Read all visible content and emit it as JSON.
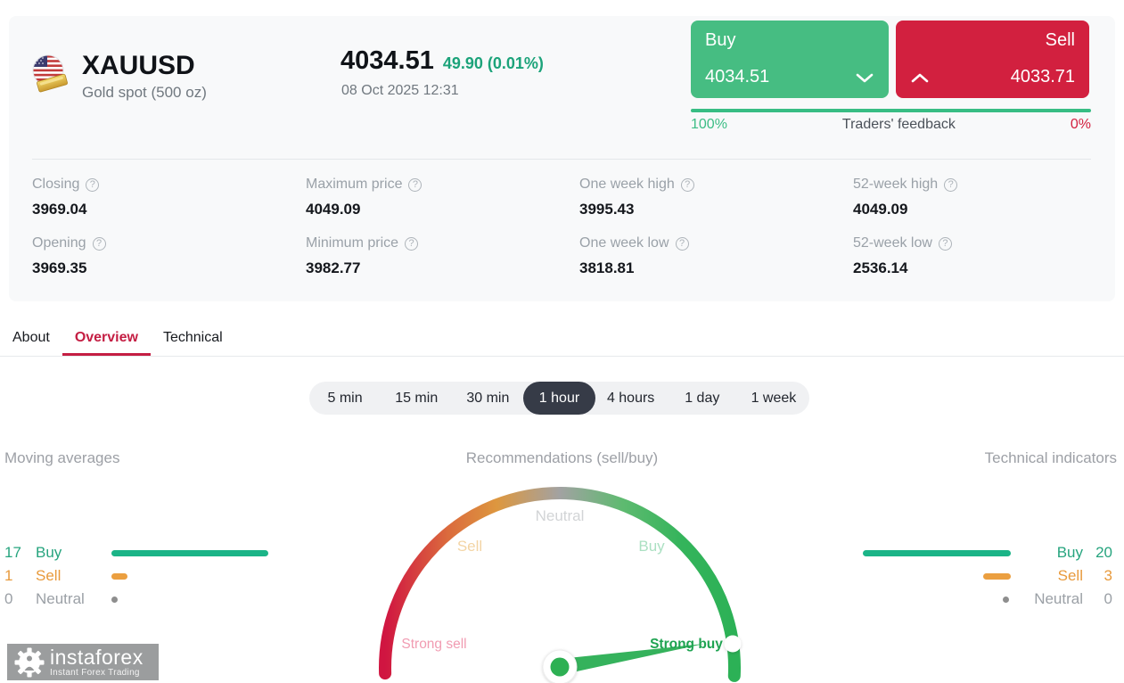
{
  "header": {
    "symbol": "XAUUSD",
    "name": "Gold spot (500 oz)",
    "price": "4034.51",
    "change": "49.90 (0.01%)",
    "datetime": "08 Oct 2025 12:31",
    "buy": {
      "label": "Buy",
      "price": "4034.51"
    },
    "sell": {
      "label": "Sell",
      "price": "4033.71"
    },
    "feedback": {
      "buy_pct": "100%",
      "label": "Traders' feedback",
      "sell_pct": "0%"
    }
  },
  "stats": {
    "closing": {
      "label": "Closing",
      "value": "3969.04"
    },
    "opening": {
      "label": "Opening",
      "value": "3969.35"
    },
    "max_price": {
      "label": "Maximum price",
      "value": "4049.09"
    },
    "min_price": {
      "label": "Minimum price",
      "value": "3982.77"
    },
    "week_high": {
      "label": "One week high",
      "value": "3995.43"
    },
    "week_low": {
      "label": "One week low",
      "value": "3818.81"
    },
    "y52_high": {
      "label": "52-week high",
      "value": "4049.09"
    },
    "y52_low": {
      "label": "52-week low",
      "value": "2536.14"
    }
  },
  "tabs": [
    {
      "label": "About",
      "active": false
    },
    {
      "label": "Overview",
      "active": true
    },
    {
      "label": "Technical",
      "active": false
    }
  ],
  "timeframes": [
    {
      "label": "5 min",
      "active": false
    },
    {
      "label": "15 min",
      "active": false
    },
    {
      "label": "30 min",
      "active": false
    },
    {
      "label": "1 hour",
      "active": true
    },
    {
      "label": "4 hours",
      "active": false
    },
    {
      "label": "1 day",
      "active": false
    },
    {
      "label": "1 week",
      "active": false
    }
  ],
  "moving_averages": {
    "title": "Moving averages",
    "rows": [
      {
        "count": "17",
        "label": "Buy"
      },
      {
        "count": "1",
        "label": "Sell"
      },
      {
        "count": "0",
        "label": "Neutral"
      }
    ]
  },
  "recommendations": {
    "title": "Recommendations (sell/buy)",
    "gauge": {
      "neutral": "Neutral",
      "sell": "Sell",
      "buy": "Buy",
      "strong_sell": "Strong sell",
      "strong_buy": "Strong buy",
      "reading": "Strong buy"
    }
  },
  "technical_indicators": {
    "title": "Technical indicators",
    "rows": [
      {
        "label": "Buy",
        "count": "20"
      },
      {
        "label": "Sell",
        "count": "3"
      },
      {
        "label": "Neutral",
        "count": "0"
      }
    ]
  },
  "watermark": {
    "brand": "instaforex",
    "tagline": "Instant Forex Trading"
  },
  "colors": {
    "buy_green": "#46bd82",
    "sell_red": "#d2203f",
    "teal": "#1bb487",
    "orange": "#eb9f40",
    "neutral_gray": "#8e8e8e",
    "tab_active": "#c41e43",
    "change_green": "#1ca37a"
  }
}
